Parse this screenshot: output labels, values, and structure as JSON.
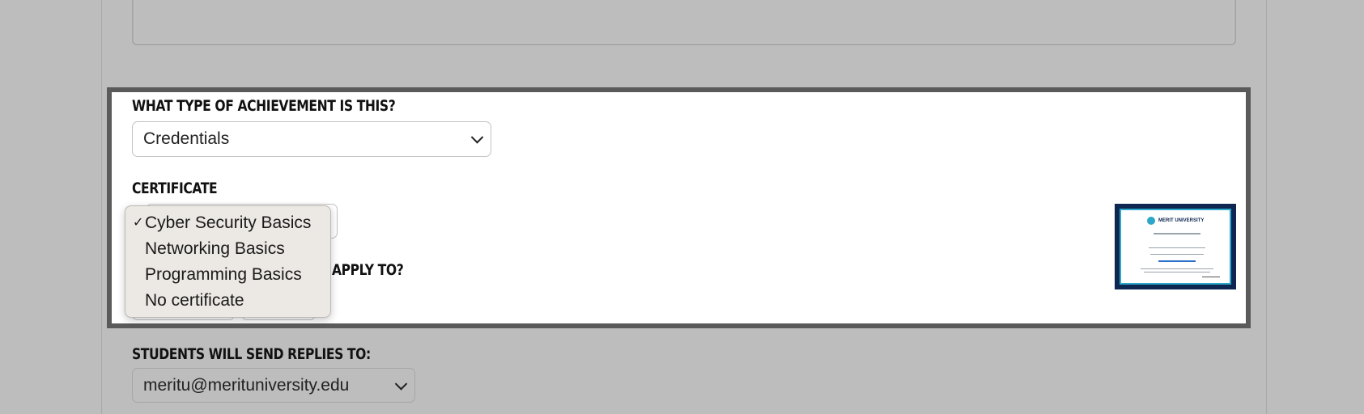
{
  "achievement": {
    "label": "WHAT TYPE OF ACHIEVEMENT IS THIS?",
    "selected": "Credentials"
  },
  "certificate": {
    "label": "CERTIFICATE",
    "options": [
      {
        "label": "Cyber Security Basics",
        "checked": true
      },
      {
        "label": "Networking Basics",
        "checked": false
      },
      {
        "label": "Programming Basics",
        "checked": false
      },
      {
        "label": "No certificate",
        "checked": false
      }
    ],
    "check_glyph": "✓",
    "thumbnail": {
      "brand": "MERIT UNIVERSITY",
      "colors": {
        "frame": "#0d2750",
        "accent": "#2aa7c9"
      }
    }
  },
  "apply_to": {
    "label_visible_part": "APPLY TO?"
  },
  "replies": {
    "label": "STUDENTS WILL SEND REPLIES TO:",
    "selected": "meritu@merituniversity.edu"
  },
  "colors": {
    "overlay_background": "#bdbdbd",
    "panel_border": "#5a5a5a",
    "panel_background": "#ffffff",
    "menu_background": "#ece8e4"
  }
}
